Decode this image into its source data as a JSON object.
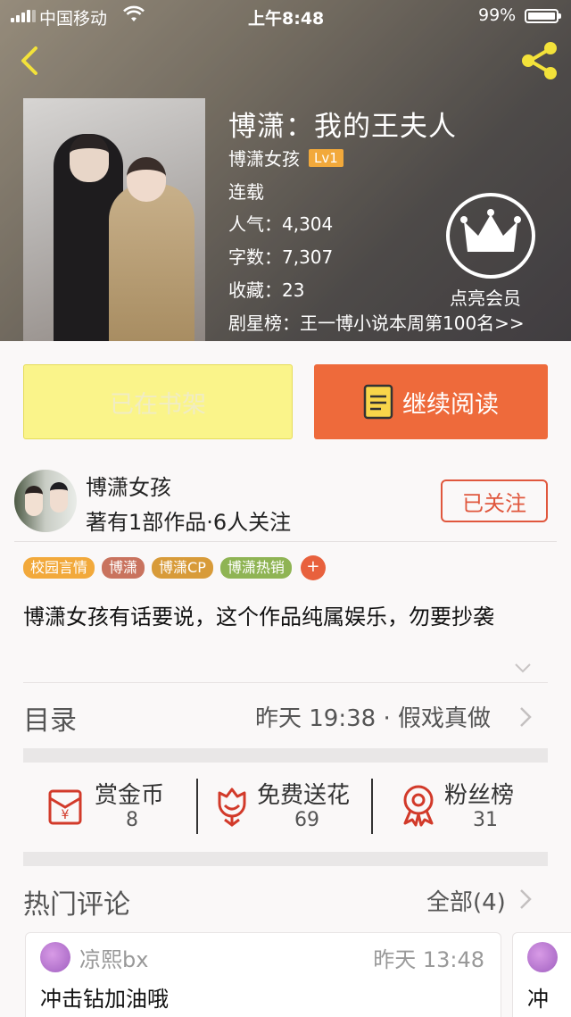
{
  "status_bar": {
    "carrier": "中国移动",
    "time": "上午8:48",
    "battery": "99%"
  },
  "book": {
    "title": "博潇：我的王夫人",
    "author": "博潇女孩",
    "level": "Lv1",
    "status": "连载",
    "popularity": "人气：4,304",
    "words": "字数：7,307",
    "favorites": "收藏：23",
    "ranking": "剧星榜：王一博小说本周第100名>>"
  },
  "vip": {
    "label": "点亮会员"
  },
  "actions": {
    "shelf": "已在书架",
    "read": "继续阅读"
  },
  "author_card": {
    "name": "博潇女孩",
    "meta": "著有1部作品·6人关注",
    "follow": "已关注"
  },
  "tags": [
    {
      "label": "校园言情",
      "color": "#f2a93b"
    },
    {
      "label": "博潇",
      "color": "#c9735e"
    },
    {
      "label": "博潇CP",
      "color": "#d89b39"
    },
    {
      "label": "博潇热销",
      "color": "#8fb454"
    }
  ],
  "tag_more": "+",
  "description": "博潇女孩有话要说，这个作品纯属娱乐，勿要抄袭",
  "catalog": {
    "title": "目录",
    "update": "昨天 19:38 · 假戏真做"
  },
  "stats": [
    {
      "label": "赏金币",
      "value": "8",
      "icon": "red-envelope-icon"
    },
    {
      "label": "免费送花",
      "value": "69",
      "icon": "flower-icon"
    },
    {
      "label": "粉丝榜",
      "value": "31",
      "icon": "medal-icon"
    }
  ],
  "comments": {
    "title": "热门评论",
    "all": "全部(4)",
    "items": [
      {
        "user": "凉熙bx",
        "time": "昨天 13:48",
        "text": "冲击钻加油哦"
      },
      {
        "user": "",
        "time": "",
        "text": "冲"
      }
    ]
  },
  "colors": {
    "accent_orange": "#ee6a3b",
    "shelf_yellow": "#faf48a",
    "follow_red": "#e0573d",
    "back_icon_yellow": "#f3e23a"
  }
}
